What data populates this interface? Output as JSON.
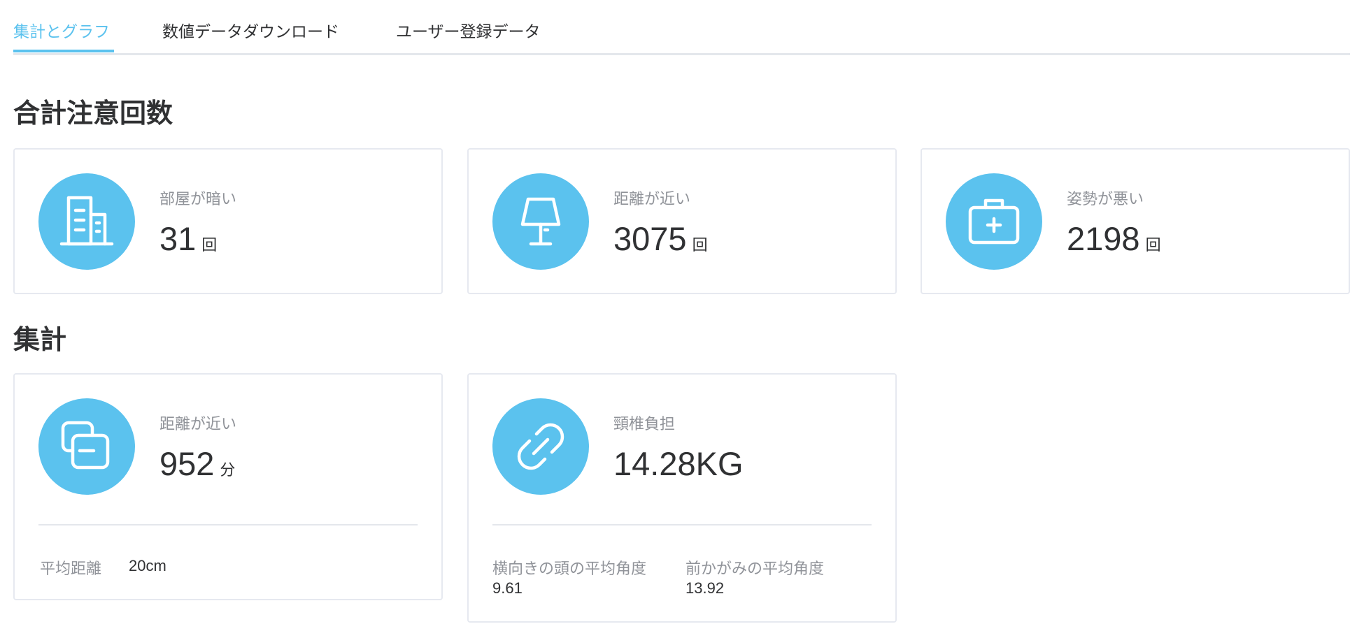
{
  "tabs": [
    "集計とグラフ",
    "数値データダウンロード",
    "ユーザー登録データ"
  ],
  "sections": {
    "totals_title": "合計注意回数",
    "summary_title": "集計"
  },
  "totals": [
    {
      "icon": "building-icon",
      "label": "部屋が暗い",
      "value": "31",
      "unit": "回"
    },
    {
      "icon": "lamp-icon",
      "label": "距離が近い",
      "value": "3075",
      "unit": "回"
    },
    {
      "icon": "first-aid-kit-icon",
      "label": "姿勢が悪い",
      "value": "2198",
      "unit": "回"
    }
  ],
  "summary": [
    {
      "icon": "overlap-squares-icon",
      "label": "距離が近い",
      "value": "952",
      "unit": "分",
      "footer": {
        "label": "平均距離",
        "value": "20cm"
      }
    },
    {
      "icon": "link-icon",
      "label": "頸椎負担",
      "value": "14.28KG",
      "footer": [
        {
          "label": "横向きの頭の平均角度",
          "value": "9.61"
        },
        {
          "label": "前かがみの平均角度",
          "value": "13.92"
        }
      ]
    }
  ],
  "colors": {
    "accent": "#5bc2ee",
    "text": "#303133",
    "muted": "#909399",
    "border": "#e6e9f0"
  }
}
